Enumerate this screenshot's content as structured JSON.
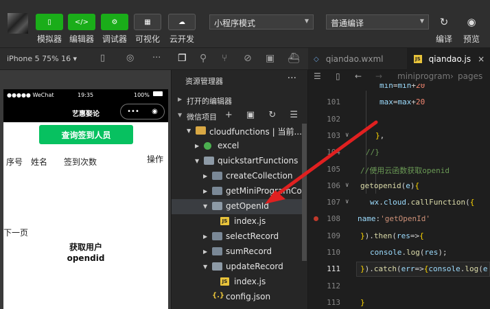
{
  "toolbar": {
    "left_tools": [
      {
        "label": "模拟器",
        "icon": "phone-icon",
        "glyph": "▯"
      },
      {
        "label": "编辑器",
        "icon": "code-icon",
        "glyph": "</>"
      },
      {
        "label": "调试器",
        "icon": "debug-icon",
        "glyph": "⚙"
      },
      {
        "label": "可视化",
        "icon": "layout-icon",
        "glyph": "▦"
      },
      {
        "label": "云开发",
        "icon": "cloud-icon",
        "glyph": "☁"
      }
    ],
    "mode_select": "小程序模式",
    "compile_select": "普通编译",
    "right_tools": [
      {
        "label": "编译",
        "icon": "refresh-icon",
        "glyph": "↻"
      },
      {
        "label": "预览",
        "icon": "eye-icon",
        "glyph": "◉"
      }
    ]
  },
  "simulator": {
    "device": "iPhone 5 75% 16 ▾",
    "status_carrier": "●●●●● WeChat",
    "status_time": "19:35",
    "status_battery": "100%",
    "nav_title": "艺惠娶论",
    "capsule_dots": "•••",
    "capsule_close": "◉",
    "query_button": "查询签到人员",
    "table_headers": [
      "序号",
      "姓名",
      "签到次数",
      "操作"
    ],
    "next_page": "下一页",
    "get_openid": "获取用户 opendid"
  },
  "explorer": {
    "title": "资源管理器",
    "more": "···",
    "open_editors": "打开的编辑器",
    "project": "微信项目",
    "project_tools": "+ ▣ ↻ ☰",
    "tree": [
      {
        "name": "cloudfunctions | 当前...",
        "type": "cloud",
        "indent": 1,
        "open": true
      },
      {
        "name": "excel",
        "type": "excel",
        "indent": 2,
        "open": false
      },
      {
        "name": "quickstartFunctions",
        "type": "folder",
        "indent": 2,
        "open": true
      },
      {
        "name": "createCollection",
        "type": "folder",
        "indent": 3,
        "open": false
      },
      {
        "name": "getMiniProgramCode",
        "type": "folder",
        "indent": 3,
        "open": false
      },
      {
        "name": "getOpenId",
        "type": "folder",
        "indent": 3,
        "open": true,
        "selected": true
      },
      {
        "name": "index.js",
        "type": "js",
        "indent": 4
      },
      {
        "name": "selectRecord",
        "type": "folder",
        "indent": 3,
        "open": false
      },
      {
        "name": "sumRecord",
        "type": "folder",
        "indent": 3,
        "open": false
      },
      {
        "name": "updateRecord",
        "type": "folder",
        "indent": 3,
        "open": true
      },
      {
        "name": "index.js",
        "type": "js",
        "indent": 4
      },
      {
        "name": "config.json",
        "type": "json",
        "indent": 3
      }
    ]
  },
  "editor": {
    "tabs": [
      {
        "label": "qiandao.wxml",
        "active": false
      },
      {
        "label": "qiandao.js",
        "active": true
      }
    ],
    "close_glyph": "×",
    "breadcrumb": [
      "miniprogram",
      "pages"
    ],
    "lines": [
      {
        "n": "",
        "code": "min=min+20"
      },
      {
        "n": "101",
        "code": "max=max+20"
      },
      {
        "n": "102",
        "code": ""
      },
      {
        "n": "103",
        "code": "},"
      },
      {
        "n": "104",
        "code": "//}"
      },
      {
        "n": "105",
        "code": "//使用云函数获取openid"
      },
      {
        "n": "106",
        "code": "getopenid(e){"
      },
      {
        "n": "107",
        "code": "wx.cloud.callFunction({"
      },
      {
        "n": "108",
        "code": "name:'getOpenId'"
      },
      {
        "n": "109",
        "code": "}).then(res=>{"
      },
      {
        "n": "110",
        "code": "console.log(res);"
      },
      {
        "n": "111",
        "code": "}).catch(err=>{console.log(e"
      },
      {
        "n": "112",
        "code": ""
      },
      {
        "n": "113",
        "code": "}"
      }
    ]
  },
  "colors": {
    "accent_green": "#1aad19",
    "annotation_red": "#e02020"
  }
}
